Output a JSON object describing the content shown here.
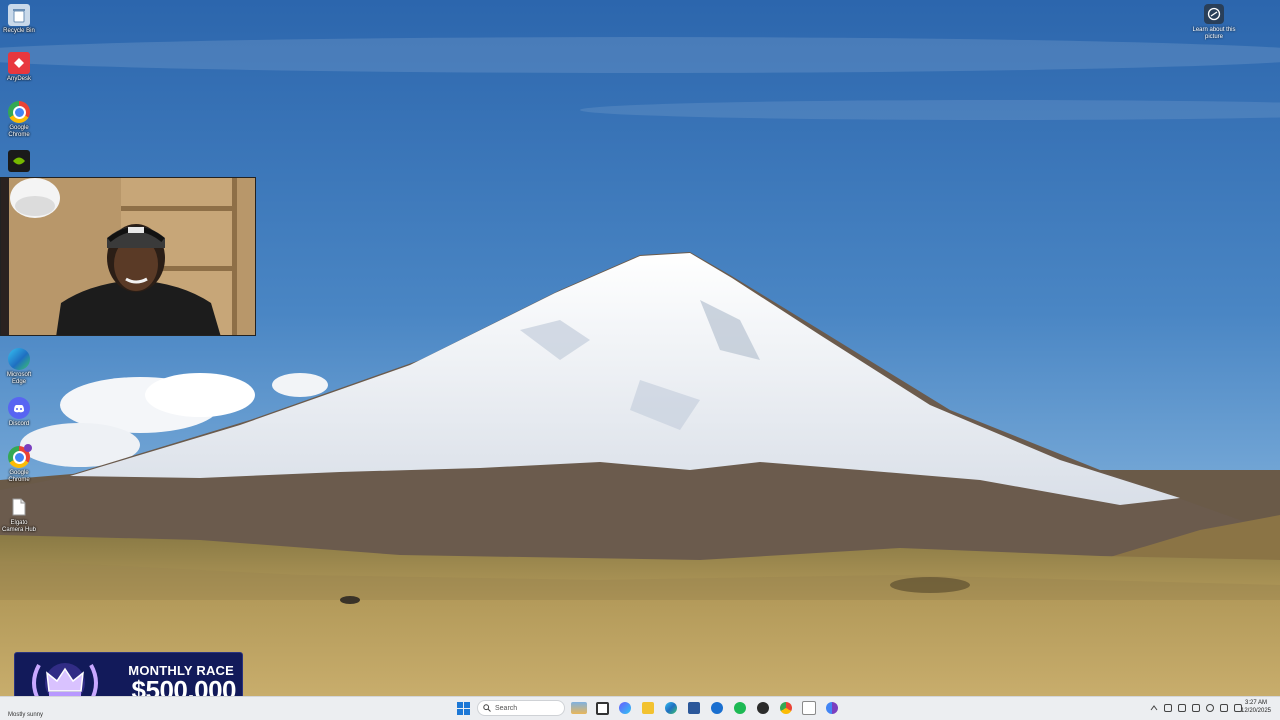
{
  "desktop": {
    "icons_upper": [
      {
        "label": "Recycle Bin",
        "icon": "recycle-bin-icon",
        "color": "#c9d9ea"
      },
      {
        "label": "AnyDesk",
        "icon": "anydesk-icon",
        "color": "#e8373e"
      },
      {
        "label": "Google Chrome",
        "icon": "chrome-icon",
        "color": "#4285f4"
      },
      {
        "label": "",
        "icon": "nvidia-icon",
        "color": "#76b900"
      }
    ],
    "icons_lower": [
      {
        "label": "Microsoft Edge",
        "icon": "edge-icon",
        "color": "#1f9bd8"
      },
      {
        "label": "Discord",
        "icon": "discord-icon",
        "color": "#5865f2"
      },
      {
        "label": "Google Chrome",
        "icon": "chrome-profile-icon",
        "color": "#4285f4"
      },
      {
        "label": "Elgato Camera Hub",
        "icon": "file-icon",
        "color": "#ffffff"
      }
    ],
    "learn_about": "Learn about this picture"
  },
  "overlay": {
    "race_title": "MONTHLY RACE",
    "race_amount": "$500,000"
  },
  "taskbar": {
    "widget_text": "Mostly sunny",
    "search_placeholder": "Search",
    "pinned": [
      {
        "icon": "landscape-widget-icon",
        "color": "#e8b65a"
      },
      {
        "icon": "task-view-icon",
        "color": "#333333"
      },
      {
        "icon": "copilot-icon",
        "color": "#6a5cff"
      },
      {
        "icon": "file-explorer-icon",
        "color": "#f2c230"
      },
      {
        "icon": "edge-icon",
        "color": "#1f9bd8"
      },
      {
        "icon": "microsoft-store-icon",
        "color": "#2b579a"
      },
      {
        "icon": "app-icon",
        "color": "#1a6fd0"
      },
      {
        "icon": "spotify-icon",
        "color": "#1db954"
      },
      {
        "icon": "obs-icon",
        "color": "#2b2b2b"
      },
      {
        "icon": "chrome-icon",
        "color": "#4285f4"
      },
      {
        "icon": "snipping-tool-icon",
        "color": "#8a8a8a"
      },
      {
        "icon": "chrome-profile-icon",
        "color": "#7b3fbf"
      }
    ],
    "time": "3:27 AM",
    "date": "12/20/2025"
  },
  "colors": {
    "sky_top": "#2f6cb3",
    "sky_bottom": "#7eb0dc",
    "taskbar_bg": "#eceef1",
    "race_bg": "#121a5a"
  }
}
